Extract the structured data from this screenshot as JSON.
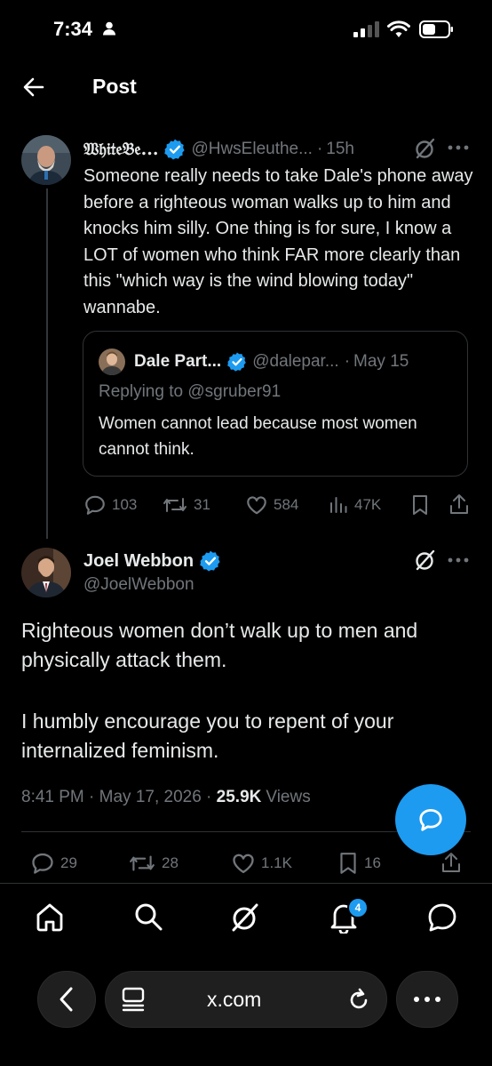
{
  "status_bar": {
    "time": "7:34"
  },
  "header": {
    "title": "Post"
  },
  "parent_tweet": {
    "display_name": "𝔚𝔥𝔦𝔱𝔢𝔅𝔢...",
    "handle": "@HwsEleuthe...",
    "separator": "·",
    "time": "15h",
    "text": "Someone really needs to take Dale's phone away before a righteous woman walks up to him and knocks him silly.  One thing is for sure, I know a LOT of women who think FAR more clearly than this \"which way is the wind blowing today\" wannabe.",
    "quote": {
      "display_name": "Dale Part...",
      "handle": "@dalepar...",
      "separator": "·",
      "date": "May 15",
      "replying_to": "Replying to @sgruber91",
      "text": "Women cannot lead because most women cannot think."
    },
    "actions": {
      "replies": "103",
      "reposts": "31",
      "likes": "584",
      "views": "47K"
    }
  },
  "main_tweet": {
    "display_name": "Joel Webbon",
    "handle": "@JoelWebbon",
    "paragraph_1": "Righteous women don’t walk up to men and physically attack them.",
    "paragraph_2": "I humbly encourage you to repent of your internalized feminism.",
    "timestamp": "8:41 PM · May 17, 2026 · ",
    "views_count": "25.9K",
    "views_label": "Views",
    "actions": {
      "replies": "29",
      "reposts": "28",
      "likes": "1.1K",
      "bookmarks": "16"
    }
  },
  "bottom_nav": {
    "notification_badge": "4"
  },
  "browser": {
    "url": "x.com"
  },
  "colors": {
    "accent": "#1d9bf0",
    "muted_text": "#71767b",
    "primary_text": "#e7e9ea",
    "divider": "#2f3336",
    "background": "#000000"
  }
}
